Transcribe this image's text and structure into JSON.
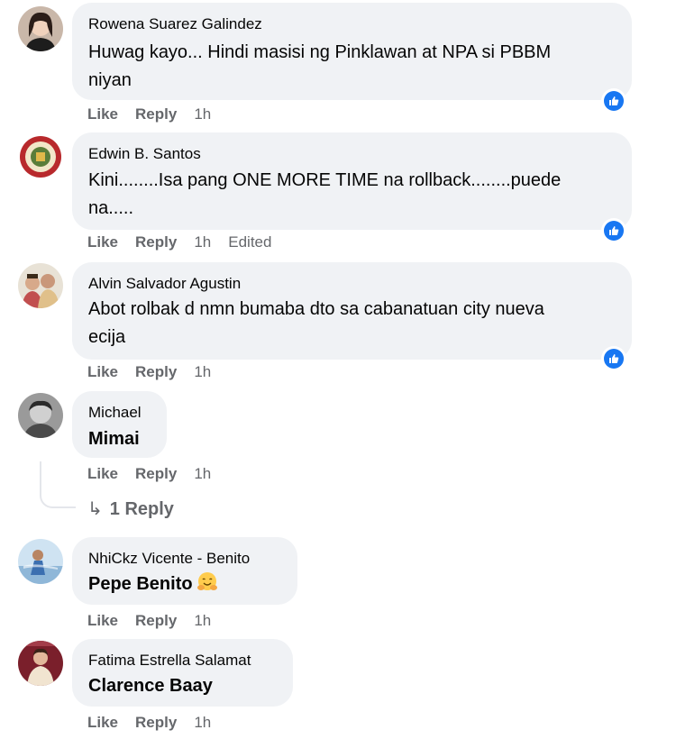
{
  "comments": [
    {
      "author": "Rowena Suarez Galindez",
      "text_line1": "Huwag kayo... Hindi masisi ng Pinklawan at NPA si PBBM",
      "text_line2": "niyan",
      "like": "Like",
      "reply": "Reply",
      "time": "1h",
      "reaction": "like"
    },
    {
      "author": "Edwin B. Santos",
      "text_line1": "Kini........Isa pang ONE MORE TIME na rollback........puede",
      "text_line2": "na.....",
      "like": "Like",
      "reply": "Reply",
      "time": "1h",
      "edited": "Edited",
      "reaction": "like"
    },
    {
      "author": "Alvin Salvador Agustin",
      "text_line1": "Abot rolbak d nmn bumaba dto sa cabanatuan city nueva",
      "text_line2": "ecija",
      "like": "Like",
      "reply": "Reply",
      "time": "1h",
      "reaction": "like"
    },
    {
      "author": "Michael",
      "text": "Mimai",
      "like": "Like",
      "reply": "Reply",
      "time": "1h"
    },
    {
      "author": "NhiCkz Vicente - Benito",
      "text": "Pepe Benito",
      "emoji": "hugging-face",
      "like": "Like",
      "reply": "Reply",
      "time": "1h"
    },
    {
      "author": "Fatima Estrella Salamat",
      "text": "Clarence Baay",
      "like": "Like",
      "reply": "Reply",
      "time": "1h"
    }
  ],
  "replies_link": {
    "arrow": "↳",
    "label": "1 Reply"
  },
  "colors": {
    "bubble": "#f0f2f5",
    "secondary_text": "#65676b",
    "like_blue": "#1877f2"
  }
}
